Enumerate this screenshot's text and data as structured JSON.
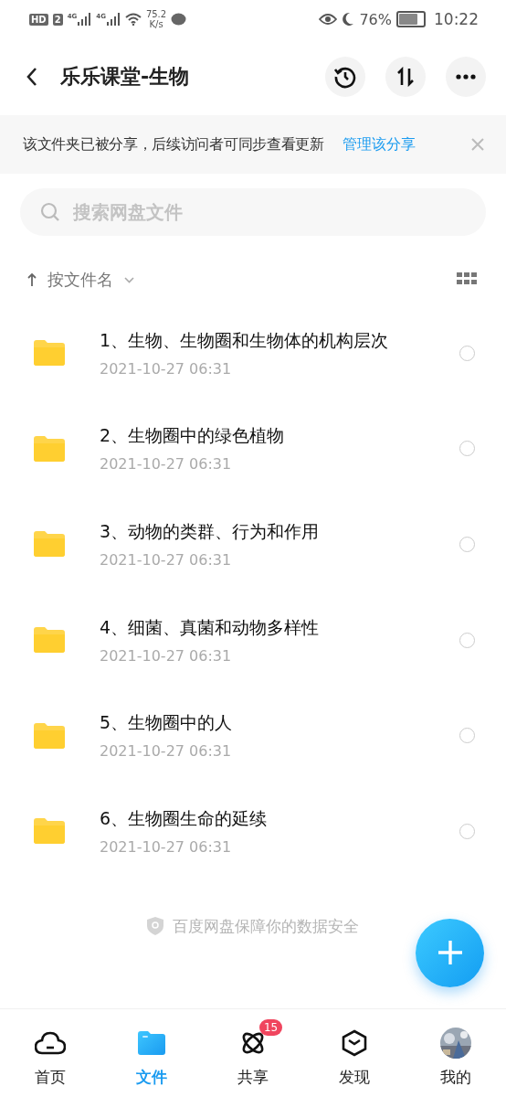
{
  "status_bar": {
    "hd": "HD",
    "sim": "2",
    "networks": [
      "4G",
      "4G"
    ],
    "speed": "75.2",
    "speed_unit": "K/s",
    "battery": "76%",
    "time": "10:22"
  },
  "header": {
    "title": "乐乐课堂-生物"
  },
  "banner": {
    "text": "该文件夹已被分享，后续访问者可同步查看更新",
    "link": "管理该分享"
  },
  "search": {
    "placeholder": "搜索网盘文件"
  },
  "sort": {
    "label": "按文件名"
  },
  "files": [
    {
      "name": "1、生物、生物圈和生物体的机构层次",
      "date": "2021-10-27  06:31",
      "selected": false
    },
    {
      "name": "2、生物圈中的绿色植物",
      "date": "2021-10-27  06:31",
      "selected": false
    },
    {
      "name": "3、动物的类群、行为和作用",
      "date": "2021-10-27  06:31",
      "selected": false
    },
    {
      "name": "4、细菌、真菌和动物多样性",
      "date": "2021-10-27  06:31",
      "selected": false
    },
    {
      "name": "5、生物圈中的人",
      "date": "2021-10-27  06:31",
      "selected": false
    },
    {
      "name": "6、生物圈生命的延续",
      "date": "2021-10-27  06:31",
      "selected": false
    }
  ],
  "footer_note": "百度网盘保障你的数据安全",
  "tabs": [
    {
      "kind": "home",
      "label": "首页",
      "selected": false
    },
    {
      "kind": "files",
      "label": "文件",
      "selected": true
    },
    {
      "kind": "share",
      "label": "共享",
      "selected": false,
      "badge": "15"
    },
    {
      "kind": "discover",
      "label": "发现",
      "selected": false
    },
    {
      "kind": "profile",
      "label": "我的",
      "selected": false
    }
  ]
}
